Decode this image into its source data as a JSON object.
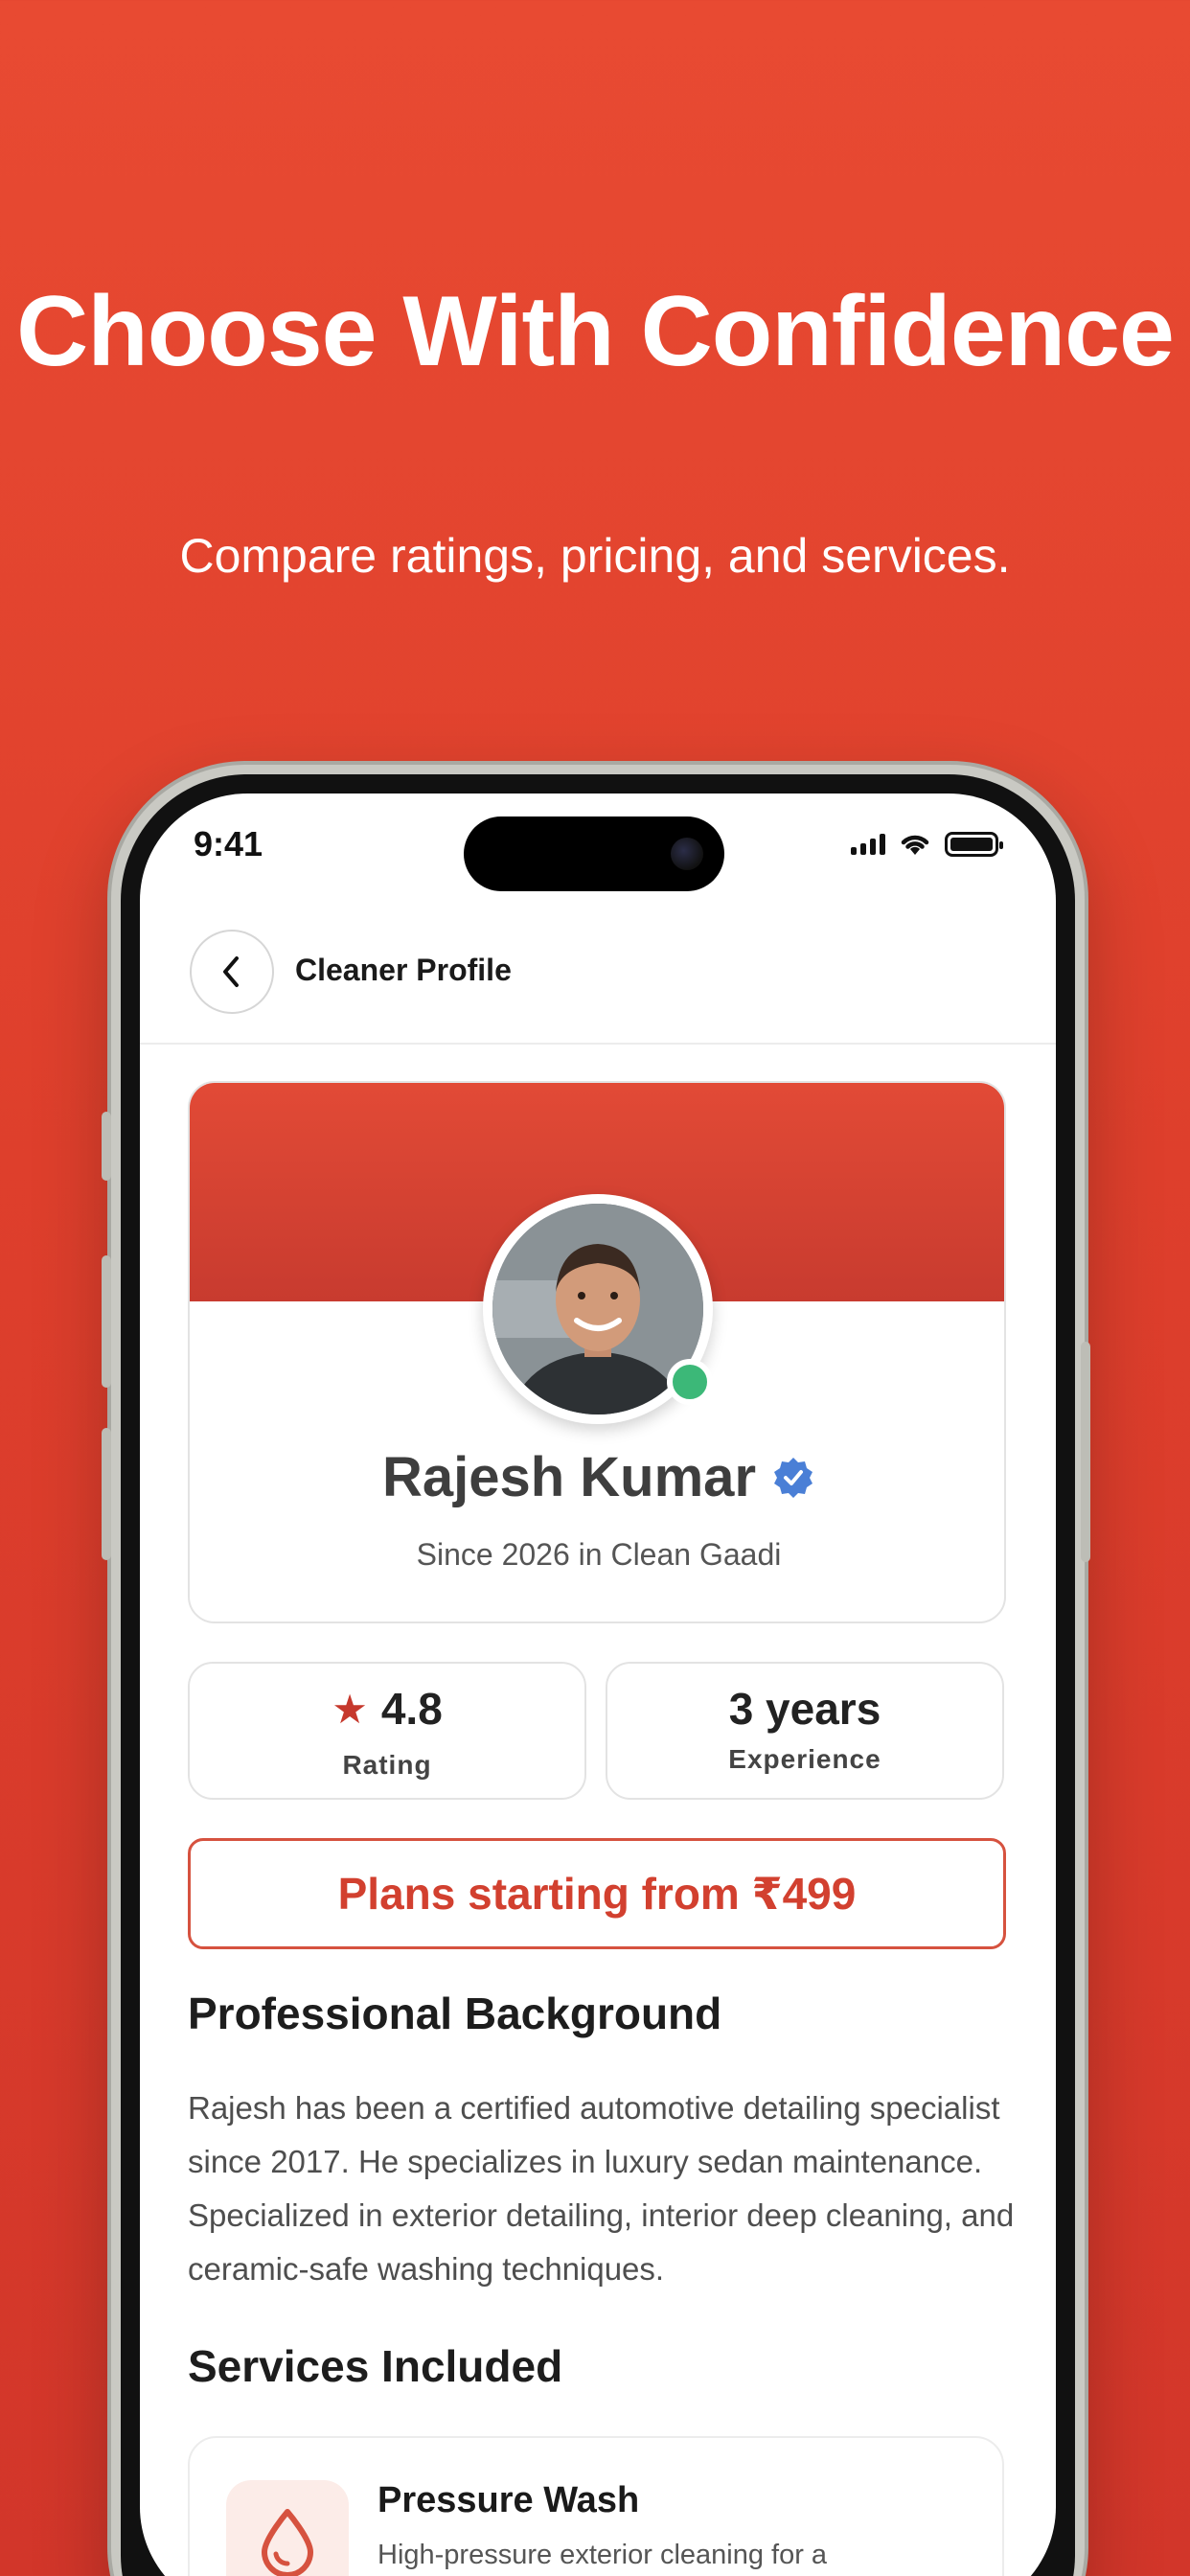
{
  "promo": {
    "title": "Choose With Confidence",
    "subtitle": "Compare ratings, pricing, and services."
  },
  "status_bar": {
    "time": "9:41"
  },
  "nav": {
    "title": "Cleaner Profile",
    "back_icon": "chevron-left-icon"
  },
  "profile": {
    "name": "Rajesh Kumar",
    "since": "Since 2026 in Clean Gaadi",
    "online": true,
    "verified": true
  },
  "stats": {
    "rating_value": "4.8",
    "rating_label": "Rating",
    "experience_value": "3 years",
    "experience_label": "Experience"
  },
  "plans_label": "Plans starting from ₹499",
  "background": {
    "heading": "Professional Background",
    "text": "Rajesh has been a certified automotive detailing specialist since 2017. He specializes in luxury sedan maintenance. Specialized in exterior detailing, interior deep cleaning, and ceramic-safe washing techniques."
  },
  "services": {
    "heading": "Services Included",
    "items": [
      {
        "title": "Pressure Wash",
        "description": "High-pressure exterior cleaning for a spotless finish",
        "icon": "water-drop-icon"
      }
    ]
  },
  "colors": {
    "brand": "#e04a34",
    "online": "#3cb878",
    "verified": "#4a7fd6"
  }
}
